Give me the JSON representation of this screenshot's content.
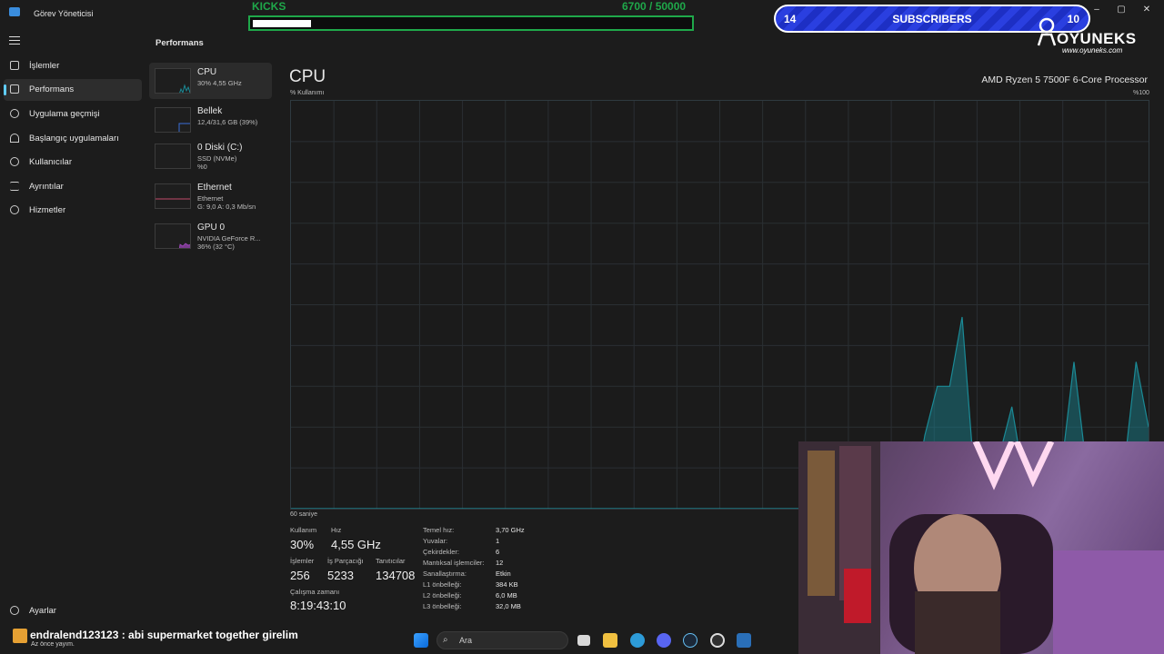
{
  "window": {
    "title": "Görev Yöneticisi",
    "controls": [
      "minimize-icon",
      "maximize-icon",
      "close-icon"
    ]
  },
  "sidebar": {
    "items": [
      {
        "label": "İşlemler",
        "icon": "processes-icon",
        "active": false
      },
      {
        "label": "Performans",
        "icon": "performance-icon",
        "active": true
      },
      {
        "label": "Uygulama geçmişi",
        "icon": "history-icon",
        "active": false
      },
      {
        "label": "Başlangıç uygulamaları",
        "icon": "startup-icon",
        "active": false
      },
      {
        "label": "Kullanıcılar",
        "icon": "users-icon",
        "active": false
      },
      {
        "label": "Ayrıntılar",
        "icon": "details-icon",
        "active": false
      },
      {
        "label": "Hizmetler",
        "icon": "services-icon",
        "active": false
      }
    ],
    "settings_label": "Ayarlar"
  },
  "page": {
    "title": "Performans"
  },
  "perf_list": [
    {
      "name": "CPU",
      "sub1": "30% 4,55 GHz",
      "sub2": "",
      "active": true
    },
    {
      "name": "Bellek",
      "sub1": "12,4/31,6 GB (39%)",
      "sub2": "",
      "active": false
    },
    {
      "name": "0 Diski (C:)",
      "sub1": "SSD (NVMe)",
      "sub2": "%0",
      "active": false
    },
    {
      "name": "Ethernet",
      "sub1": "Ethernet",
      "sub2": "G: 9,0 A: 0,3 Mb/sn",
      "active": false
    },
    {
      "name": "GPU 0",
      "sub1": "NVIDIA GeForce R...",
      "sub2": "36% (32 °C)",
      "active": false
    }
  ],
  "cpu": {
    "heading": "CPU",
    "model": "AMD Ryzen 5 7500F 6-Core Processor",
    "graph_label": "% Kullanımı",
    "graph_max": "%100",
    "graph_time": "60 saniye",
    "usage_series": [
      0,
      0,
      0,
      0,
      0,
      0,
      0,
      0,
      0,
      0,
      0,
      0,
      0,
      0,
      0,
      0,
      0,
      0,
      0,
      0,
      0,
      0,
      0,
      0,
      0,
      0,
      0,
      0,
      0,
      0,
      0,
      0,
      0,
      0,
      0,
      0,
      0,
      0,
      0,
      0,
      0,
      0,
      0,
      0,
      0,
      0,
      0,
      0,
      0,
      0,
      0,
      18,
      30,
      30,
      47,
      7,
      6,
      13,
      25,
      7,
      0,
      0,
      10,
      36,
      10,
      8,
      0,
      9,
      36,
      20
    ]
  },
  "stats": {
    "utilization_label": "Kullanım",
    "utilization_value": "30%",
    "speed_label": "Hız",
    "speed_value": "4,55 GHz",
    "processes_label": "İşlemler",
    "processes_value": "256",
    "threads_label": "İş Parçacığı",
    "threads_value": "5233",
    "handles_label": "Tanıtıcılar",
    "handles_value": "134708",
    "uptime_label": "Çalışma zamanı",
    "uptime_value": "8:19:43:10"
  },
  "specs": [
    {
      "label": "Temel hız:",
      "value": "3,70 GHz"
    },
    {
      "label": "Yuvalar:",
      "value": "1"
    },
    {
      "label": "Çekirdekler:",
      "value": "6"
    },
    {
      "label": "Mantıksal işlemciler:",
      "value": "12"
    },
    {
      "label": "Sanallaştırma:",
      "value": "Etkin"
    },
    {
      "label": "L1 önbelleği:",
      "value": "384 KB"
    },
    {
      "label": "L2 önbelleği:",
      "value": "6,0 MB"
    },
    {
      "label": "L3 önbelleği:",
      "value": "32,0 MB"
    }
  ],
  "overlay": {
    "kicks_label": "KICKS",
    "kicks_count": "6700  / 50000",
    "kicks_progress": 0.134,
    "subs_left": "14",
    "subs_text": "SUBSCRIBERS",
    "subs_right": "10",
    "brand": "OYUNEKS",
    "brand_url": "www.oyuneks.com",
    "chat_user_msg": "endralend123123 : abi supermarket together girelim",
    "chat_time": "Az önce yayım."
  },
  "taskbar": {
    "search_placeholder": "Ara",
    "icons": [
      "windows-start-icon",
      "search-icon",
      "task-view-icon",
      "file-explorer-icon",
      "edge-icon",
      "discord-icon",
      "steam-icon",
      "obs-icon",
      "task-manager-icon"
    ]
  },
  "colors": {
    "accent": "#60cdff",
    "cpu_graph_stroke": "#1b8a96",
    "kicks_green": "#1fa84a",
    "subs_blue": "#1d2fc4"
  }
}
